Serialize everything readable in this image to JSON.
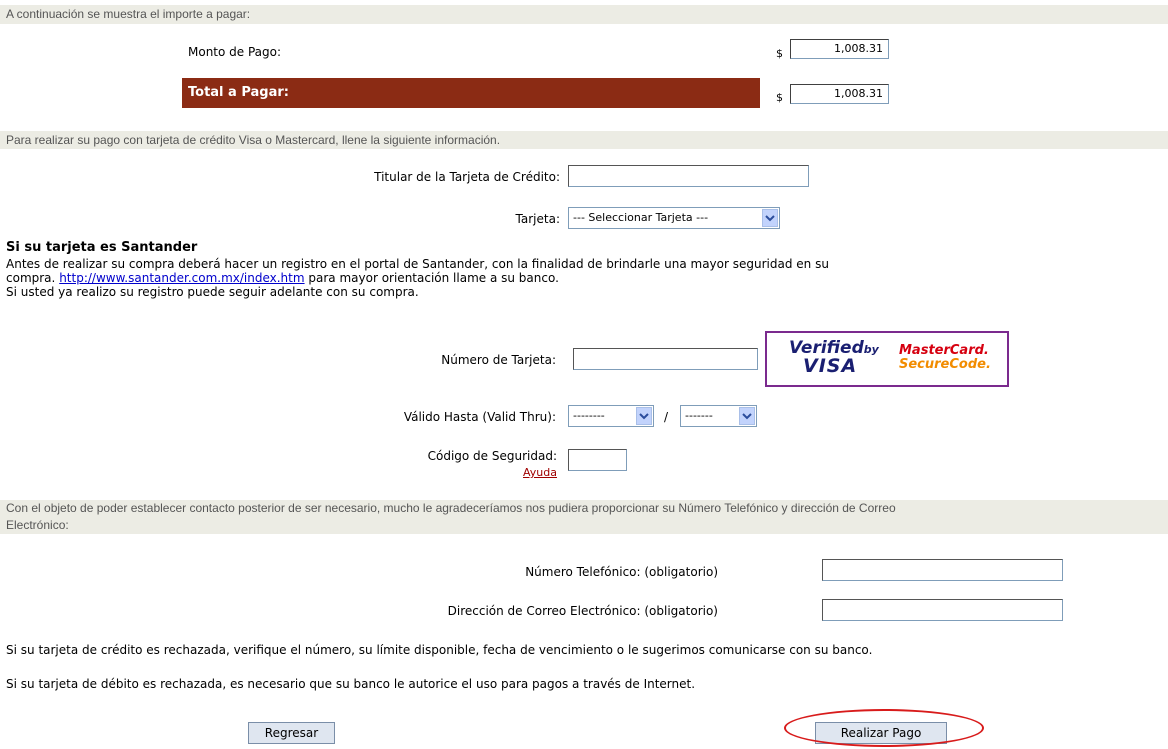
{
  "amounts": {
    "intro": "A continuación se muestra el importe a pagar:",
    "monto_label": "Monto de Pago:",
    "currency_symbol": "$",
    "monto_value": "1,008.31",
    "total_label": "Total a Pagar:",
    "total_value": "1,008.31"
  },
  "card_section": {
    "intro": "Para realizar su pago con tarjeta de crédito Visa o Mastercard, llene la siguiente información.",
    "holder_label": "Titular de la Tarjeta de Crédito:",
    "holder_value": "",
    "card_type_label": "Tarjeta:",
    "card_type_selected": "--- Seleccionar Tarjeta ---"
  },
  "santander": {
    "title": "Si su tarjeta es Santander",
    "line1": "Antes de realizar su compra deberá hacer un registro en el portal de Santander, con la finalidad de brindarle una mayor seguridad en su",
    "line2_prefix": "compra.",
    "link_text": "http://www.santander.com.mx/index.htm",
    "line2_suffix": "para mayor orientación llame a su banco.",
    "line3": "Si usted ya realizo su registro puede seguir adelante con su compra."
  },
  "card_details": {
    "number_label": "Número de Tarjeta:",
    "number_value": "",
    "logos": {
      "visa_line1": "Verified",
      "visa_by": "by",
      "visa_line2": "VISA",
      "mc_line1": "MasterCard.",
      "mc_line2": "SecureCode."
    },
    "valid_label": "Válido Hasta (Valid Thru):",
    "month_selected": "--------",
    "separator": "/",
    "year_selected": "-------",
    "cvv_label": "Código de Seguridad:",
    "help_link": "Ayuda",
    "cvv_value": ""
  },
  "contact": {
    "intro_line1": "Con el objeto de poder establecer contacto posterior de ser necesario, mucho le agradeceríamos nos pudiera proporcionar su Número Telefónico y dirección de Correo",
    "intro_line2": "Electrónico:",
    "phone_label": "Número Telefónico: (obligatorio)",
    "phone_value": "",
    "email_label": "Dirección de Correo Electrónico: (obligatorio)",
    "email_value": ""
  },
  "notes": {
    "credit": "Si su tarjeta de crédito es rechazada, verifique el número, su límite disponible, fecha de vencimiento o le sugerimos comunicarse con su banco.",
    "debit": "Si su tarjeta de débito es rechazada, es necesario que su banco le autorice el uso para pagos a través de Internet."
  },
  "buttons": {
    "back": "Regresar",
    "pay": "Realizar Pago"
  },
  "colors": {
    "total_bar": "#8b2b14",
    "band": "#ecece4",
    "logo_border": "#7b2a8e",
    "highlight_oval": "#d81b1b"
  }
}
